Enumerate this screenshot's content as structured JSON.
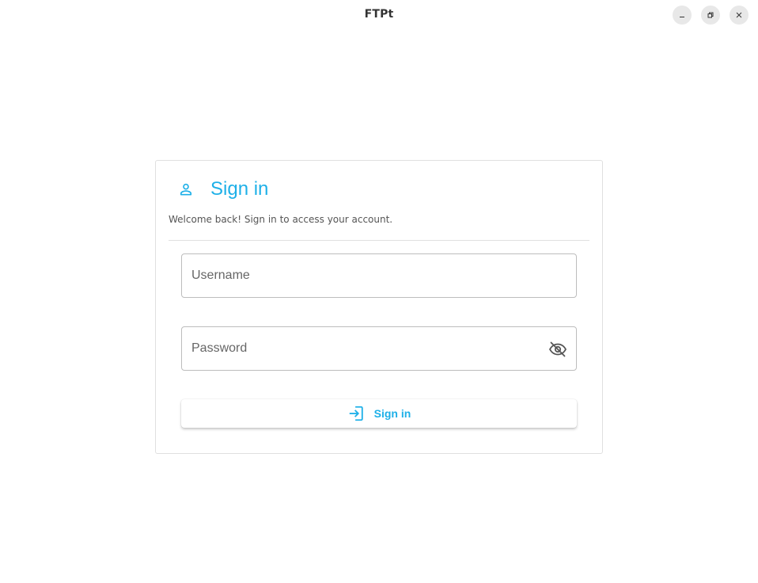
{
  "window": {
    "title": "FTPt",
    "controls": {
      "minimize_icon": "minimize-icon",
      "maximize_icon": "restore-icon",
      "close_icon": "close-icon"
    }
  },
  "signin": {
    "header_icon": "person-icon",
    "title": "Sign in",
    "subtitle": "Welcome back! Sign in to access your account.",
    "username": {
      "placeholder": "Username",
      "value": ""
    },
    "password": {
      "placeholder": "Password",
      "value": "",
      "toggle_icon": "eye-off-icon"
    },
    "button": {
      "label": "Sign in",
      "icon": "login-icon"
    }
  },
  "colors": {
    "accent": "#1eb0e8",
    "border": "#bdbdbd",
    "divider": "#e0e0e0",
    "window_button_bg": "#e8e8e8"
  }
}
